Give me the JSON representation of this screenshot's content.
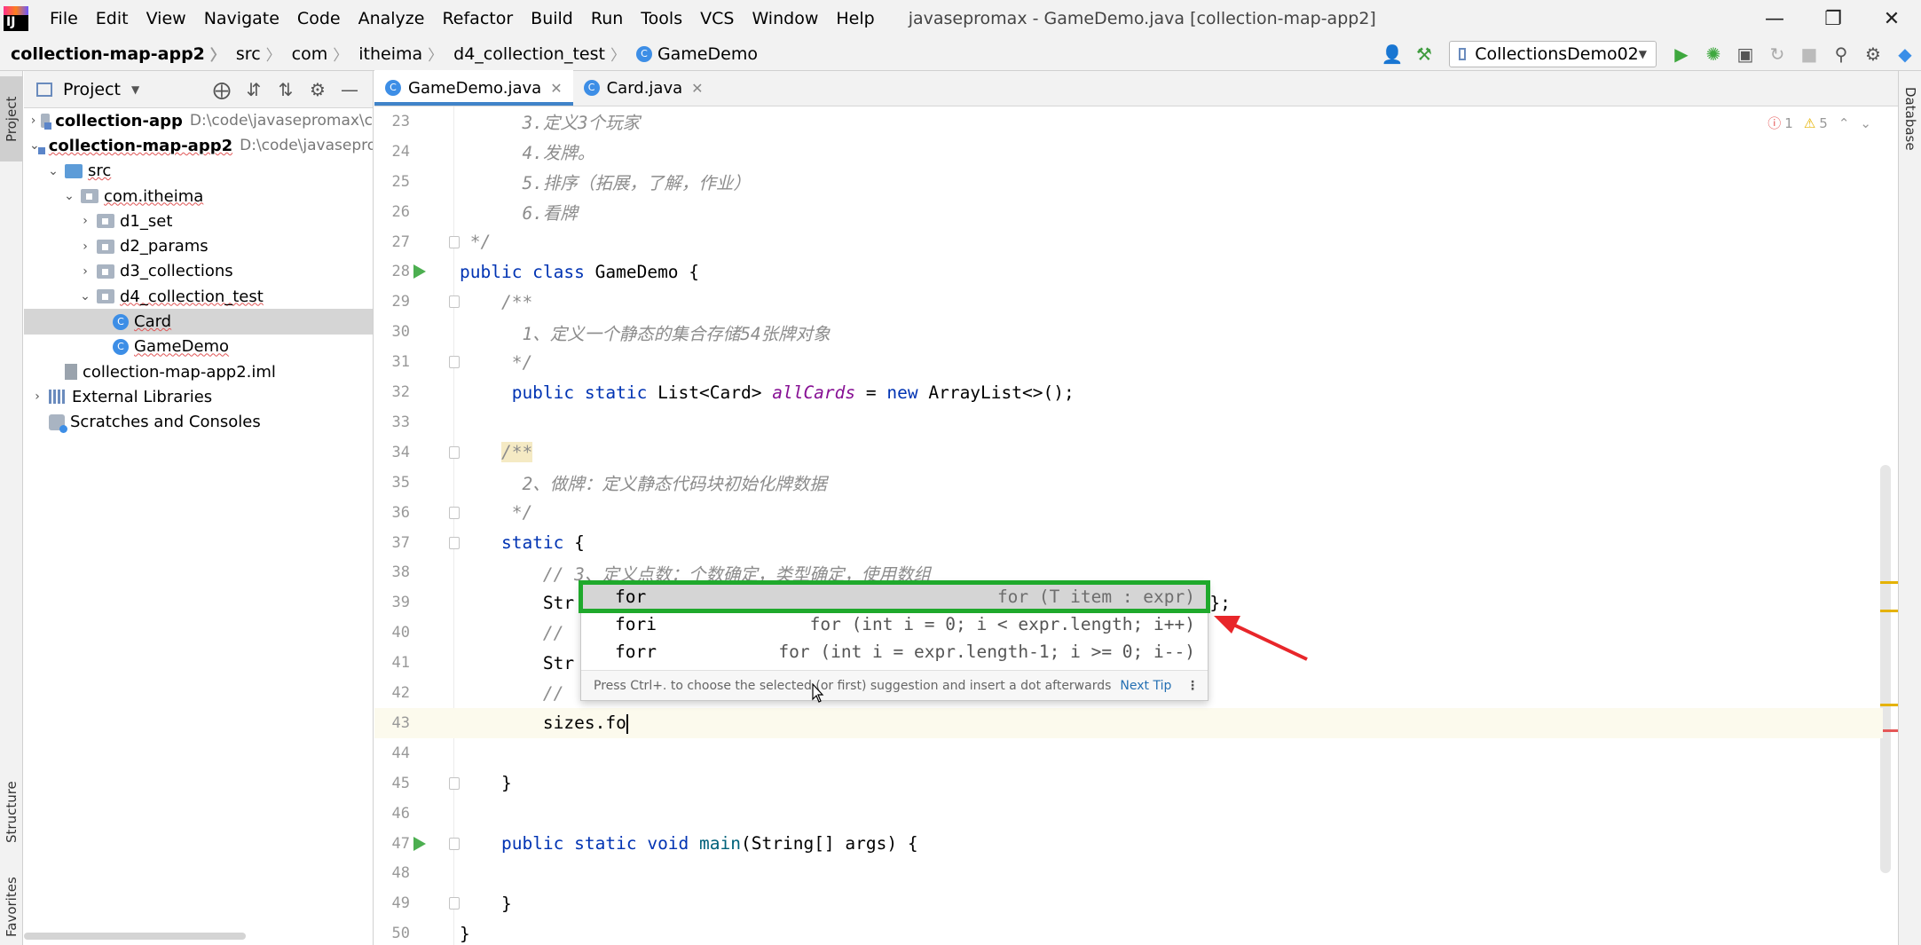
{
  "menu": {
    "items": [
      "File",
      "Edit",
      "View",
      "Navigate",
      "Code",
      "Analyze",
      "Refactor",
      "Build",
      "Run",
      "Tools",
      "VCS",
      "Window",
      "Help"
    ],
    "window_title": "javasepromax - GameDemo.java [collection-map-app2]"
  },
  "breadcrumb": [
    "collection-map-app2",
    "src",
    "com",
    "itheima",
    "d4_collection_test",
    "GameDemo"
  ],
  "run_config": "CollectionsDemo02",
  "left_stripe": {
    "project": "Project",
    "structure": "Structure",
    "favorites": "Favorites"
  },
  "right_stripe": {
    "database": "Database"
  },
  "project_panel": {
    "title": "Project",
    "tree": [
      {
        "label": "collection-app",
        "path": "D:\\code\\javasepromax\\c",
        "arrow": "›",
        "icon": "module",
        "bold": true,
        "indent": 0
      },
      {
        "label": "collection-map-app2",
        "path": "D:\\code\\javasepro",
        "arrow": "⌄",
        "icon": "module",
        "bold": true,
        "indent": 0
      },
      {
        "label": "src",
        "path": "",
        "arrow": "⌄",
        "icon": "src",
        "bold": false,
        "indent": 1
      },
      {
        "label": "com.itheima",
        "path": "",
        "arrow": "⌄",
        "icon": "pkg",
        "bold": false,
        "indent": 2
      },
      {
        "label": "d1_set",
        "path": "",
        "arrow": "›",
        "icon": "pkg",
        "bold": false,
        "indent": 3
      },
      {
        "label": "d2_params",
        "path": "",
        "arrow": "›",
        "icon": "pkg",
        "bold": false,
        "indent": 3
      },
      {
        "label": "d3_collections",
        "path": "",
        "arrow": "›",
        "icon": "pkg",
        "bold": false,
        "indent": 3
      },
      {
        "label": "d4_collection_test",
        "path": "",
        "arrow": "⌄",
        "icon": "pkg",
        "bold": false,
        "indent": 3
      },
      {
        "label": "Card",
        "path": "",
        "arrow": "",
        "icon": "cls",
        "bold": false,
        "indent": 4
      },
      {
        "label": "GameDemo",
        "path": "",
        "arrow": "",
        "icon": "cls",
        "bold": false,
        "indent": 4
      },
      {
        "label": "collection-map-app2.iml",
        "path": "",
        "arrow": "",
        "icon": "iml",
        "bold": false,
        "indent": 1
      },
      {
        "label": "External Libraries",
        "path": "",
        "arrow": "›",
        "icon": "lib",
        "bold": false,
        "indent": 0
      },
      {
        "label": "Scratches and Consoles",
        "path": "",
        "arrow": "",
        "icon": "scratch",
        "bold": false,
        "indent": 0
      }
    ]
  },
  "tabs": [
    {
      "label": "GameDemo.java",
      "active": true
    },
    {
      "label": "Card.java",
      "active": false
    }
  ],
  "inspections": {
    "errors": "1",
    "warnings": "5"
  },
  "editor_lines": [
    {
      "n": "23",
      "html": "      <span class=\"cm\">3.定义3个玩家</span>"
    },
    {
      "n": "24",
      "html": "      <span class=\"cm\">4.发牌。</span>"
    },
    {
      "n": "25",
      "html": "      <span class=\"cm\">5.排序（拓展，了解，作业）</span>"
    },
    {
      "n": "26",
      "html": "      <span class=\"cm\">6.看牌</span>"
    },
    {
      "n": "27",
      "html": " <span class=\"cm\">*/</span>"
    },
    {
      "n": "28",
      "html": "<span class=\"kw\">public class</span> GameDemo {"
    },
    {
      "n": "29",
      "html": "    <span class=\"cm\">/**</span>"
    },
    {
      "n": "30",
      "html": "      <span class=\"cm\">1、定义一个静态的集合存储54张牌对象</span>"
    },
    {
      "n": "31",
      "html": "     <span class=\"cm\">*/</span>"
    },
    {
      "n": "32",
      "html": "     <span class=\"kw\">public static</span> List&lt;Card&gt; <span class=\"fld\">allCards</span> = <span class=\"kw\">new</span> ArrayList&lt;&gt;();"
    },
    {
      "n": "33",
      "html": ""
    },
    {
      "n": "34",
      "html": "    <span class=\"cm highlight-doc\">/**</span>"
    },
    {
      "n": "35",
      "html": "      <span class=\"cm\">2、做牌：定义静态代码块初始化牌数据</span>"
    },
    {
      "n": "36",
      "html": "     <span class=\"cm\">*/</span>"
    },
    {
      "n": "37",
      "html": "    <span class=\"kw\">static</span> {"
    },
    {
      "n": "38",
      "html": "        <span class=\"cm\">// 3、定义点数：个数确定，类型确定，使用数组</span>"
    },
    {
      "n": "39",
      "html": "        Str                                                   <span class=\"str\">K\"</span>,<span class=\"str\">\"A\"</span>,<span class=\"str\">\"2\"</span>};"
    },
    {
      "n": "40",
      "html": "        <span class=\"cm\">//</span>"
    },
    {
      "n": "41",
      "html": "        Str"
    },
    {
      "n": "42",
      "html": "        <span class=\"cm\">//</span>"
    },
    {
      "n": "43",
      "html": "        sizes.fo<span class=\"caret-line\"></span>"
    },
    {
      "n": "44",
      "html": ""
    },
    {
      "n": "45",
      "html": "    }"
    },
    {
      "n": "46",
      "html": ""
    },
    {
      "n": "47",
      "html": "    <span class=\"kw\">public static void</span> <span class=\"fn\">main</span>(String[] args) {"
    },
    {
      "n": "48",
      "html": ""
    },
    {
      "n": "49",
      "html": "    }"
    },
    {
      "n": "50",
      "html": "}"
    }
  ],
  "completion": {
    "items": [
      {
        "keyword": "for",
        "template": "for (T item : expr)",
        "selected": true
      },
      {
        "keyword": "fori",
        "template": "for (int i = 0; i < expr.length; i++)",
        "selected": false
      },
      {
        "keyword": "forr",
        "template": "for (int i = expr.length-1; i >= 0; i--)",
        "selected": false
      }
    ],
    "hint": "Press Ctrl+. to choose the selected (or first) suggestion and insert a dot afterwards",
    "next_tip": "Next Tip"
  },
  "colors": {
    "selection_outline": "#1fa92c",
    "annotation_arrow": "#e8262a",
    "tab_underline": "#4083c9"
  }
}
